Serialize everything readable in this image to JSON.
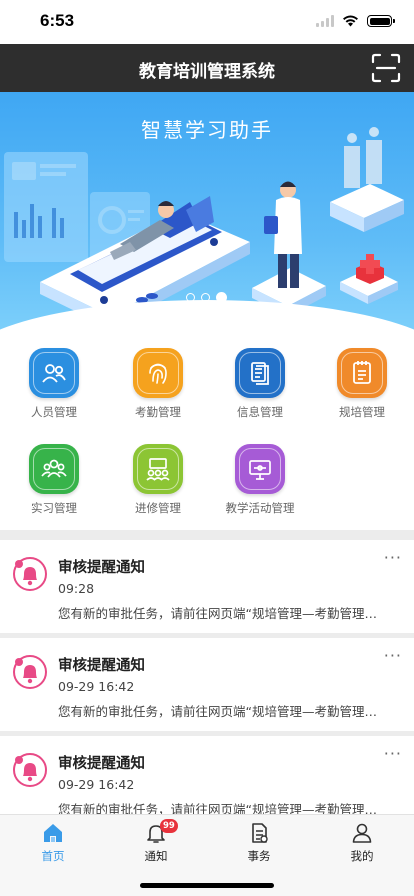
{
  "status": {
    "time": "6:53"
  },
  "nav": {
    "title": "教育培训管理系统",
    "scan_icon": "scan-icon"
  },
  "banner": {
    "title": "智慧学习助手",
    "slides": 3,
    "active_slide": 3
  },
  "grid": {
    "items": [
      {
        "label": "人员管理",
        "icon": "people-icon",
        "color": "#2b8fe0"
      },
      {
        "label": "考勤管理",
        "icon": "fingerprint-icon",
        "color": "#f5a21e"
      },
      {
        "label": "信息管理",
        "icon": "document-icon",
        "color": "#2371c8"
      },
      {
        "label": "规培管理",
        "icon": "notebook-icon",
        "color": "#f08a2a"
      },
      {
        "label": "实习管理",
        "icon": "people-group-icon",
        "color": "#37b34a"
      },
      {
        "label": "进修管理",
        "icon": "classroom-icon",
        "color": "#8cc534"
      },
      {
        "label": "教学活动管理",
        "icon": "presentation-icon",
        "color": "#a65bd6"
      }
    ]
  },
  "notices": [
    {
      "title": "审核提醒通知",
      "time": "09:28",
      "text": "您有新的审批任务，请前往网页端“规培管理—考勤管理—请假审批”进行审批",
      "more": "···"
    },
    {
      "title": "审核提醒通知",
      "time": "09-29 16:42",
      "text": "您有新的审批任务，请前往网页端“规培管理—考勤管理—请假审批”进行审批",
      "more": "···"
    },
    {
      "title": "审核提醒通知",
      "time": "09-29 16:42",
      "text": "您有新的审批任务，请前往网页端“规培管理—考勤管理—请假审批”进行审批",
      "more": "···"
    }
  ],
  "tabs": [
    {
      "label": "首页",
      "icon": "home-icon",
      "active": true
    },
    {
      "label": "通知",
      "icon": "bell-icon",
      "badge": "99"
    },
    {
      "label": "事务",
      "icon": "task-icon"
    },
    {
      "label": "我的",
      "icon": "user-icon"
    }
  ],
  "colors": {
    "nav_bg": "#2e2e2e",
    "accent": "#3a9be8",
    "badge": "#e8323c",
    "notice_icon": "#e84a86"
  }
}
